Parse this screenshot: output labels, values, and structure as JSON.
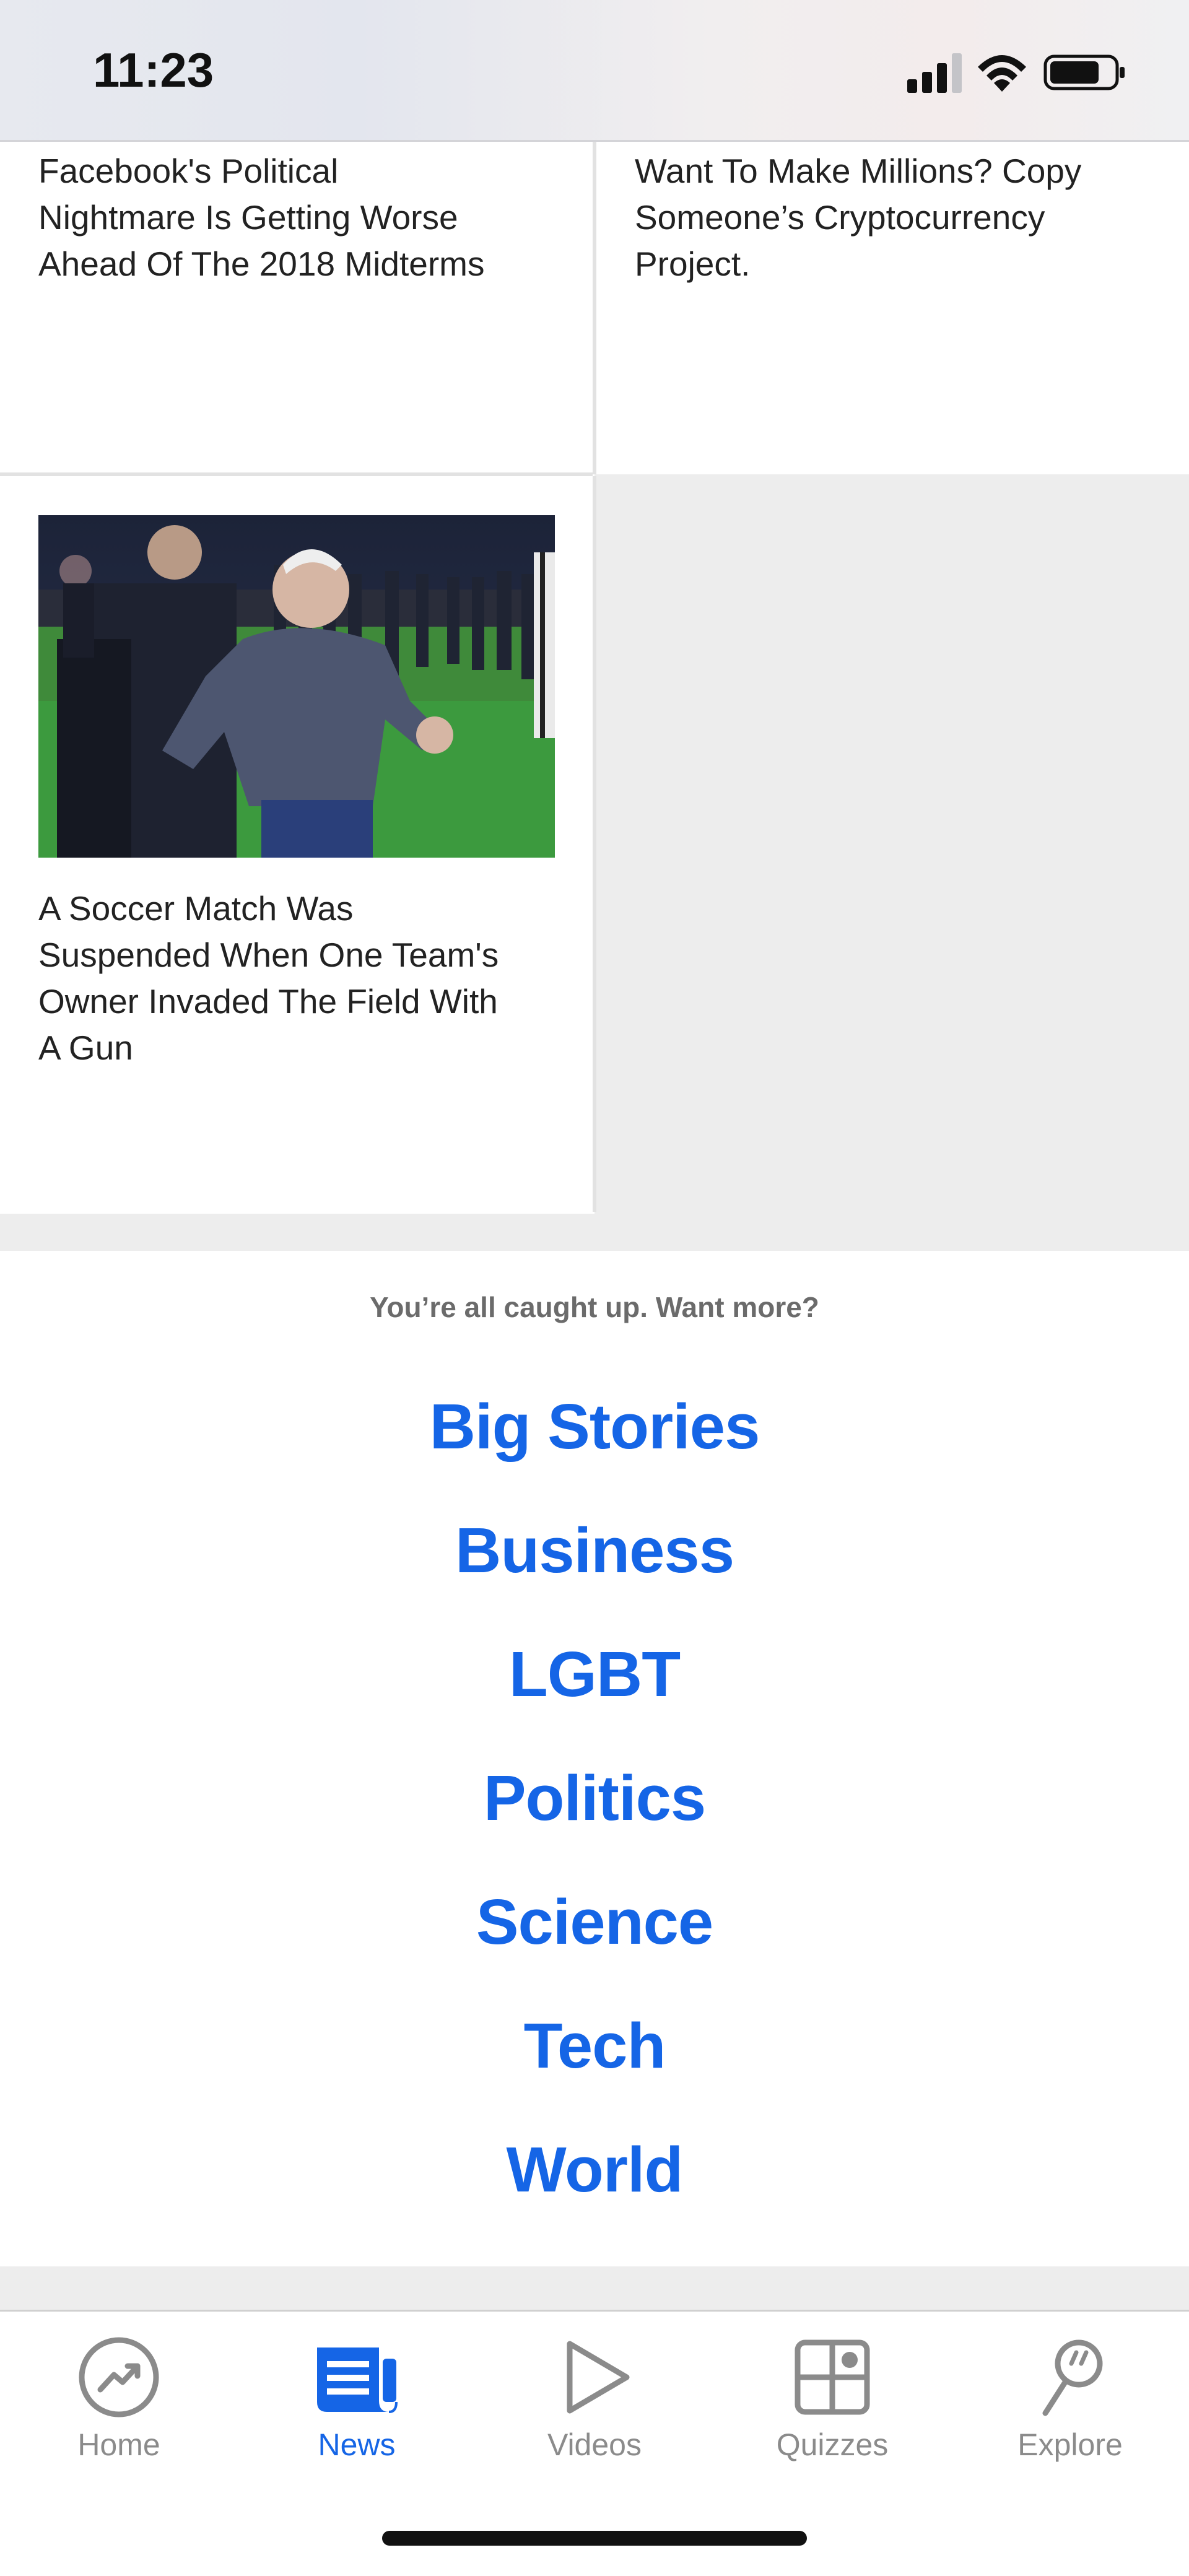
{
  "status_bar": {
    "time": "11:23"
  },
  "articles": [
    {
      "title_lines": [
        "Facebook's Political",
        "Nightmare Is Getting Worse",
        "Ahead Of The 2018 Midterms"
      ]
    },
    {
      "title_lines": [
        "Want To Make Millions? Copy",
        "Someone’s Cryptocurrency",
        "Project."
      ]
    },
    {
      "title_lines": [
        "A Soccer Match Was",
        "Suspended When One Team's",
        "Owner Invaded The Field With",
        "A Gun"
      ]
    }
  ],
  "more": {
    "prompt": "You’re all caught up. Want more?",
    "topics": [
      "Big Stories",
      "Business",
      "LGBT",
      "Politics",
      "Science",
      "Tech",
      "World"
    ]
  },
  "tab_bar": {
    "tabs": [
      {
        "label": "Home",
        "icon": "trending-icon",
        "active": false
      },
      {
        "label": "News",
        "icon": "news-icon",
        "active": true
      },
      {
        "label": "Videos",
        "icon": "play-icon",
        "active": false
      },
      {
        "label": "Quizzes",
        "icon": "quizzes-icon",
        "active": false
      },
      {
        "label": "Explore",
        "icon": "explore-icon",
        "active": false
      }
    ]
  },
  "colors": {
    "accent": "#1565e6",
    "inactive": "#8b8b8b",
    "grey_bg": "#ededed"
  }
}
